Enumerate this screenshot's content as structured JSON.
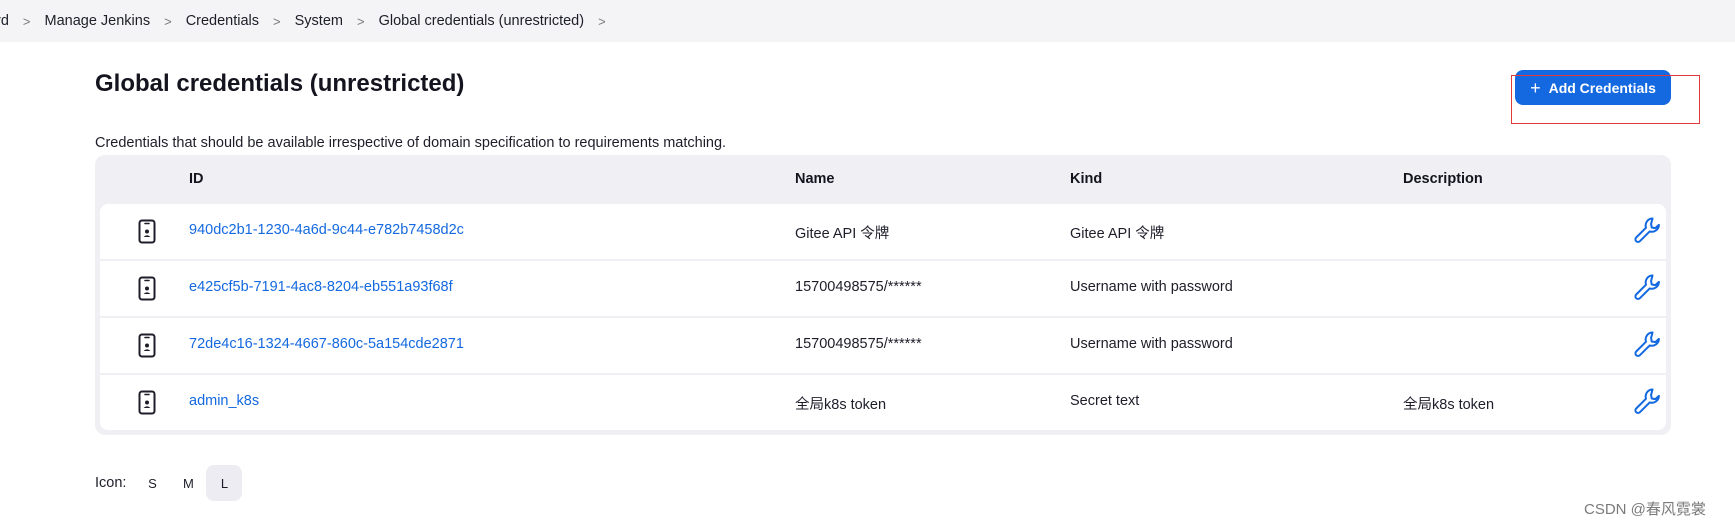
{
  "breadcrumb": {
    "items": [
      "rd",
      "Manage Jenkins",
      "Credentials",
      "System",
      "Global credentials (unrestricted)"
    ],
    "separator": ">"
  },
  "page": {
    "title": "Global credentials (unrestricted)",
    "subtitle": "Credentials that should be available irrespective of domain specification to requirements matching.",
    "add_button_label": "Add Credentials"
  },
  "table": {
    "columns": {
      "id": "ID",
      "name": "Name",
      "kind": "Kind",
      "description": "Description"
    },
    "rows": [
      {
        "id": "940dc2b1-1230-4a6d-9c44-e782b7458d2c",
        "name": "Gitee API 令牌",
        "kind": "Gitee API 令牌",
        "description": ""
      },
      {
        "id": "e425cf5b-7191-4ac8-8204-eb551a93f68f",
        "name": "15700498575/******",
        "kind": "Username with password",
        "description": ""
      },
      {
        "id": "72de4c16-1324-4667-860c-5a154cde2871",
        "name": "15700498575/******",
        "kind": "Username with password",
        "description": ""
      },
      {
        "id": "admin_k8s",
        "name": "全局k8s token",
        "kind": "Secret text",
        "description": "全局k8s token"
      }
    ]
  },
  "icon_size": {
    "label": "Icon:",
    "options": [
      "S",
      "M",
      "L"
    ],
    "selected": "L"
  },
  "watermark": "CSDN @春风霓裳",
  "colors": {
    "accent": "#1469e0",
    "highlight_box": "#e23a3a",
    "breadcrumb_bg": "#f4f4f6",
    "table_bg": "#f0f0f4"
  },
  "icons": {
    "row_icon": "phone-credential-icon",
    "row_action": "wrench-icon",
    "add": "plus-icon"
  }
}
